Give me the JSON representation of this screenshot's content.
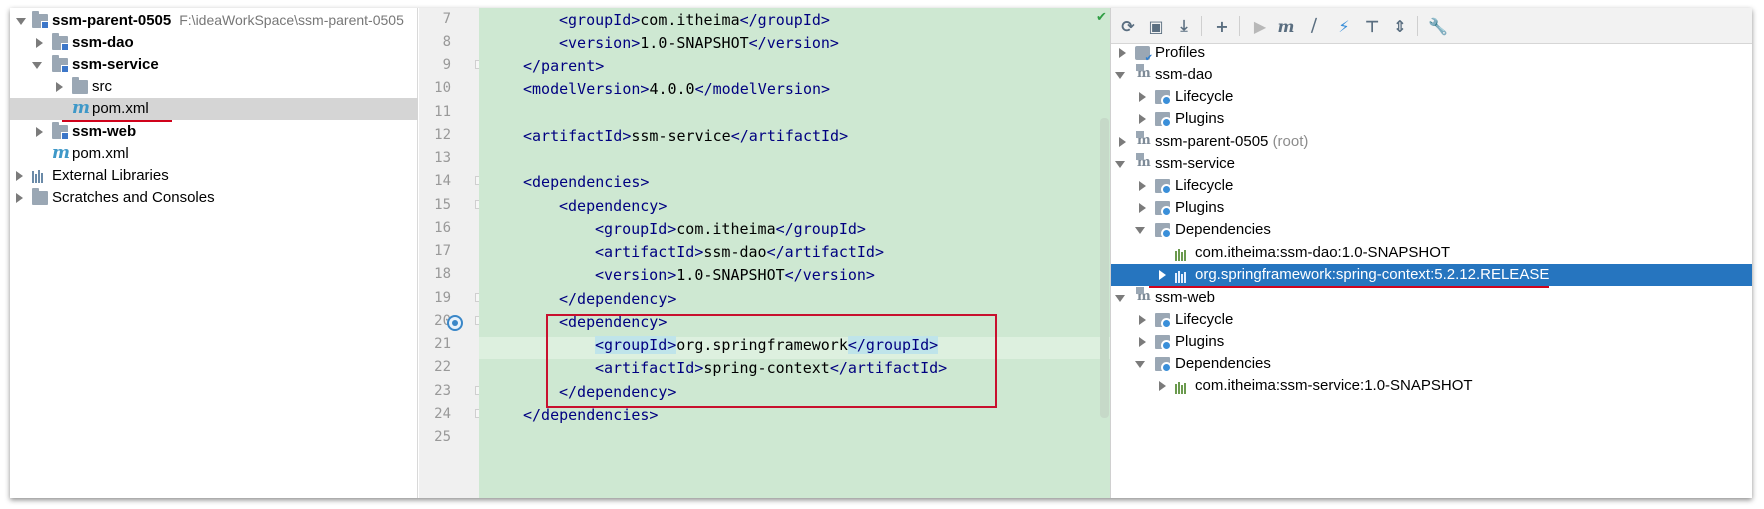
{
  "project_tree": {
    "root": {
      "name": "ssm-parent-0505",
      "path": "F:\\ideaWorkSpace\\ssm-parent-0505"
    },
    "items": [
      {
        "label": "ssm-dao"
      },
      {
        "label": "ssm-service"
      },
      {
        "label": "src"
      },
      {
        "label": "pom.xml"
      },
      {
        "label": "ssm-web"
      },
      {
        "label": "pom.xml"
      },
      {
        "label": "External Libraries"
      },
      {
        "label": "Scratches and Consoles"
      }
    ]
  },
  "editor": {
    "line_numbers": [
      "7",
      "8",
      "9",
      "10",
      "11",
      "12",
      "13",
      "14",
      "15",
      "16",
      "17",
      "18",
      "19",
      "20",
      "21",
      "22",
      "23",
      "24",
      "25"
    ],
    "lines": [
      {
        "open": "<groupId>",
        "text": "com.itheima",
        "close": "</groupId>"
      },
      {
        "open": "<version>",
        "text": "1.0-SNAPSHOT",
        "close": "</version>"
      },
      {
        "open": "</parent>",
        "text": "",
        "close": ""
      },
      {
        "open": "<modelVersion>",
        "text": "4.0.0",
        "close": "</modelVersion>"
      },
      {
        "open": "",
        "text": "",
        "close": ""
      },
      {
        "open": "<artifactId>",
        "text": "ssm-service",
        "close": "</artifactId>"
      },
      {
        "open": "",
        "text": "",
        "close": ""
      },
      {
        "open": "<dependencies>",
        "text": "",
        "close": ""
      },
      {
        "open": "<dependency>",
        "text": "",
        "close": ""
      },
      {
        "open": "<groupId>",
        "text": "com.itheima",
        "close": "</groupId>"
      },
      {
        "open": "<artifactId>",
        "text": "ssm-dao",
        "close": "</artifactId>"
      },
      {
        "open": "<version>",
        "text": "1.0-SNAPSHOT",
        "close": "</version>"
      },
      {
        "open": "</dependency>",
        "text": "",
        "close": ""
      },
      {
        "open": "<dependency>",
        "text": "",
        "close": ""
      },
      {
        "open": "<groupId>",
        "text": "org.springframework",
        "close": "</groupId>"
      },
      {
        "open": "<artifactId>",
        "text": "spring-context",
        "close": "</artifactId>"
      },
      {
        "open": "</dependency>",
        "text": "",
        "close": ""
      },
      {
        "open": "</dependencies>",
        "text": "",
        "close": ""
      }
    ]
  },
  "maven": {
    "toolbar": [
      "reload-icon",
      "generate-sources-icon",
      "download-icon",
      "add-icon",
      "run-icon",
      "maven-goal-icon",
      "skip-tests-icon",
      "offline-icon",
      "show-dependencies-icon",
      "collapse-all-icon",
      "settings-icon"
    ],
    "tree": [
      {
        "label": "Profiles"
      },
      {
        "label": "ssm-dao"
      },
      {
        "label": "Lifecycle"
      },
      {
        "label": "Plugins"
      },
      {
        "label": "ssm-parent-0505",
        "suffix": "(root)"
      },
      {
        "label": "ssm-service"
      },
      {
        "label": "Lifecycle"
      },
      {
        "label": "Plugins"
      },
      {
        "label": "Dependencies"
      },
      {
        "label": "com.itheima:ssm-dao:1.0-SNAPSHOT"
      },
      {
        "label": "org.springframework:spring-context:5.2.12.RELEASE"
      },
      {
        "label": "ssm-web"
      },
      {
        "label": "Lifecycle"
      },
      {
        "label": "Plugins"
      },
      {
        "label": "Dependencies"
      },
      {
        "label": "com.itheima:ssm-service:1.0-SNAPSHOT"
      }
    ]
  },
  "colors": {
    "editor_bg": "#cee8d2",
    "tag": "#000080",
    "selection": "#2675bf",
    "annotation_red": "#c8102e"
  }
}
